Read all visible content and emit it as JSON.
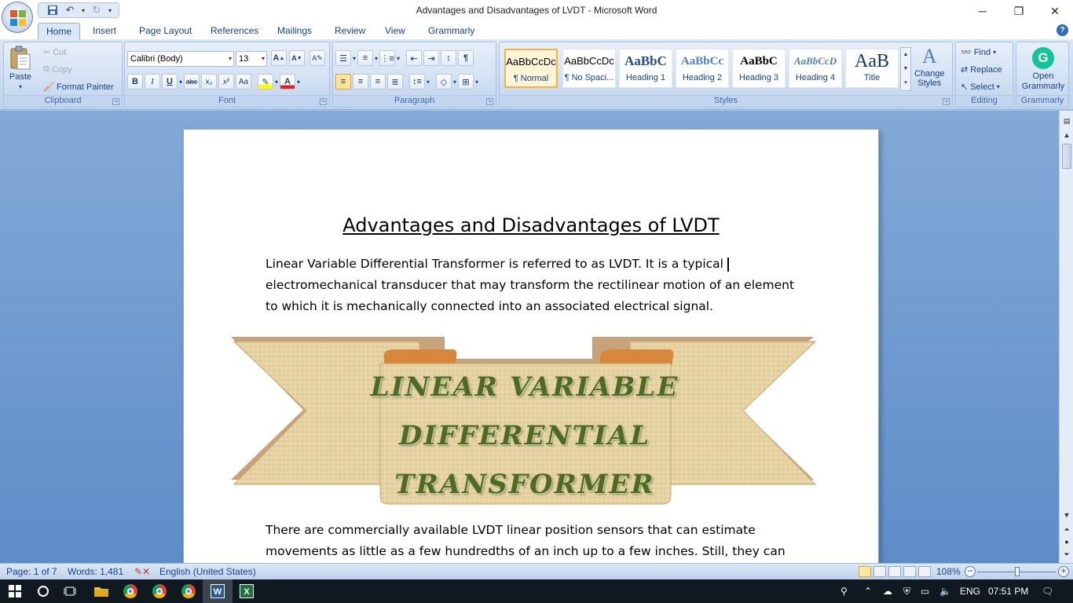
{
  "window": {
    "title": "Advantages and Disadvantages of LVDT - Microsoft Word",
    "minimize_icon": "minimize-icon",
    "restore_icon": "restore-icon",
    "close_icon": "close-icon"
  },
  "tabs": [
    "Home",
    "Insert",
    "Page Layout",
    "References",
    "Mailings",
    "Review",
    "View",
    "Grammarly"
  ],
  "active_tab": "Home",
  "ribbon": {
    "clipboard": {
      "label": "Clipboard",
      "paste": "Paste",
      "cut": "Cut",
      "copy": "Copy",
      "format_painter": "Format Painter"
    },
    "font": {
      "label": "Font",
      "font_name": "Calibri (Body)",
      "font_size": "13",
      "grow": "A",
      "shrink": "A",
      "bold": "B",
      "italic": "I",
      "underline": "U",
      "strike": "abc",
      "subscript": "x₂",
      "superscript": "x²",
      "change_case": "Aa"
    },
    "paragraph": {
      "label": "Paragraph",
      "pilcrow": "¶"
    },
    "styles": {
      "label": "Styles",
      "items": [
        {
          "sample": "AaBbCcDc",
          "name": "¶ Normal"
        },
        {
          "sample": "AaBbCcDc",
          "name": "¶ No Spaci..."
        },
        {
          "sample": "AaBbC",
          "name": "Heading 1"
        },
        {
          "sample": "AaBbCc",
          "name": "Heading 2"
        },
        {
          "sample": "AaBbC",
          "name": "Heading 3"
        },
        {
          "sample": "AaBbCcD",
          "name": "Heading 4"
        },
        {
          "sample": "AaB",
          "name": "Title"
        }
      ],
      "change_styles_1": "Change",
      "change_styles_2": "Styles"
    },
    "editing": {
      "label": "Editing",
      "find": "Find",
      "replace": "Replace",
      "select": "Select"
    },
    "grammarly": {
      "label": "Grammarly",
      "open_1": "Open",
      "open_2": "Grammarly"
    }
  },
  "document": {
    "heading": "Advantages and Disadvantages of LVDT",
    "para1": [
      "Linear Variable Differential Transformer is referred to as LVDT. It is a typical",
      "electromechanical transducer that may transform the rectilinear motion of an element",
      "to which it is mechanically connected into an associated electrical signal."
    ],
    "banner": [
      "LINEAR VARIABLE",
      "DIFFERENTIAL",
      "TRANSFORMER"
    ],
    "para2": [
      "There are commercially available LVDT linear position sensors that can estimate",
      "movements as little as a few hundredths of an inch up to a few inches. Still, they can"
    ]
  },
  "status": {
    "page": "Page: 1 of 7",
    "words": "Words: 1,481",
    "language": "English (United States)",
    "zoom": "108%",
    "zoom_level_percent": 108
  },
  "taskbar": {
    "language": "ENG",
    "time": "07:51 PM"
  }
}
